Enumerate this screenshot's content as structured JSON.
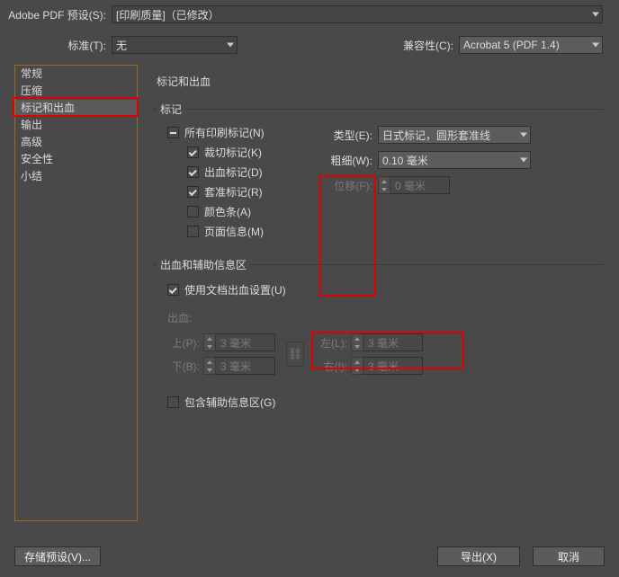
{
  "preset": {
    "label": "Adobe PDF 预设(S):",
    "value": "[印刷质量]（已修改）"
  },
  "standard": {
    "label": "标准(T):",
    "value": "无"
  },
  "compat": {
    "label": "兼容性(C):",
    "value": "Acrobat 5 (PDF 1.4)"
  },
  "sidebar": {
    "items": [
      {
        "label": "常规"
      },
      {
        "label": "压缩"
      },
      {
        "label": "标记和出血"
      },
      {
        "label": "输出"
      },
      {
        "label": "高级"
      },
      {
        "label": "安全性"
      },
      {
        "label": "小结"
      }
    ],
    "selected_index": 2
  },
  "page_title": "标记和出血",
  "marks": {
    "legend": "标记",
    "all": "所有印刷标记(N)",
    "crop": "裁切标记(K)",
    "bleed_m": "出血标记(D)",
    "reg": "套准标记(R)",
    "colorbars": "颜色条(A)",
    "pageinfo": "页面信息(M)",
    "type_label": "类型(E):",
    "type_value": "日式标记，圆形套准线",
    "weight_label": "粗细(W):",
    "weight_value": "0.10 毫米",
    "offset_label": "位移(F):",
    "offset_value": "0 毫米"
  },
  "bleed": {
    "legend": "出血和辅助信息区",
    "use_doc": "使用文档出血设置(U)",
    "bleed_label": "出血:",
    "top_label": "上(P):",
    "top_value": "3 毫米",
    "bottom_label": "下(B):",
    "bottom_value": "3 毫米",
    "left_label": "左(L):",
    "left_value": "3 毫米",
    "right_label": "右(I):",
    "right_value": "3 毫米",
    "slug": "包含辅助信息区(G)"
  },
  "buttons": {
    "save_preset": "存储预设(V)...",
    "export": "导出(X)",
    "cancel": "取消"
  }
}
